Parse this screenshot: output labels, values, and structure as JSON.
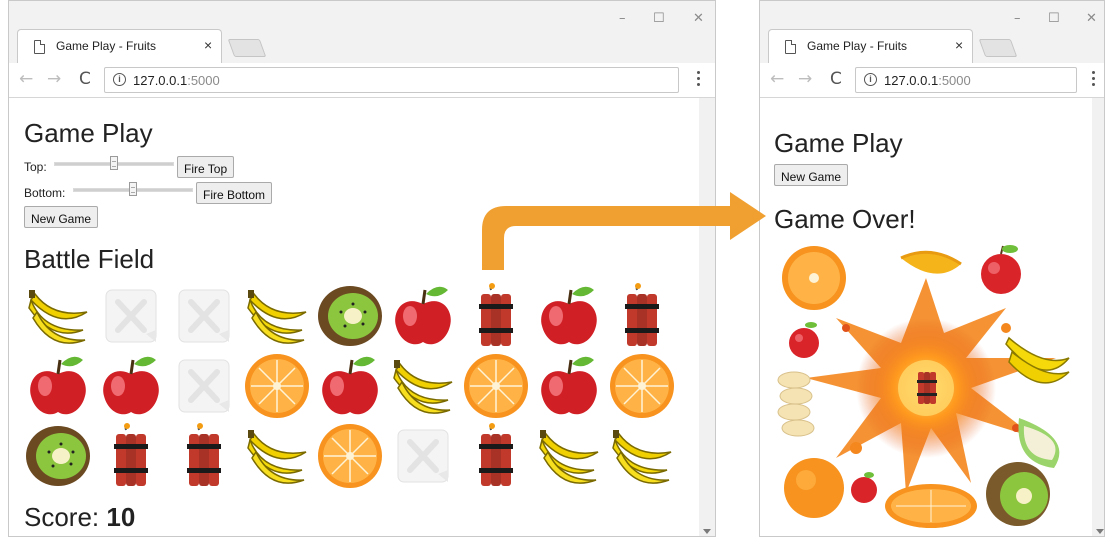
{
  "left_window": {
    "tab_title": "Game Play - Fruits",
    "tab_close": "×",
    "url_host": "127.0.0.1",
    "url_port": ":5000",
    "heading": "Game Play",
    "top_label": "Top:",
    "top_slider_value": 0.5,
    "fire_top": "Fire Top",
    "bottom_label": "Bottom:",
    "bottom_slider_value": 0.5,
    "fire_bottom": "Fire Bottom",
    "new_game": "New Game",
    "battle_heading": "Battle Field",
    "score_label": "Score:",
    "score_value": "10",
    "grid": [
      [
        "banana",
        "empty",
        "empty",
        "banana",
        "kiwi",
        "apple",
        "dynamite",
        "apple",
        "dynamite"
      ],
      [
        "apple",
        "apple",
        "empty",
        "orange",
        "apple",
        "banana",
        "orange",
        "apple",
        "orange"
      ],
      [
        "kiwi",
        "dynamite",
        "dynamite",
        "banana",
        "orange",
        "empty",
        "dynamite",
        "banana",
        "banana"
      ]
    ]
  },
  "right_window": {
    "tab_title": "Game Play - Fruits",
    "tab_close": "×",
    "url_host": "127.0.0.1",
    "url_port": ":5000",
    "heading": "Game Play",
    "new_game": "New Game",
    "game_over": "Game Over!",
    "scattered_items": [
      "orange",
      "mango",
      "apple",
      "apple",
      "banana",
      "banana-slices",
      "dynamite",
      "apple-slice",
      "orange",
      "apple",
      "orange-slice",
      "kiwi"
    ]
  },
  "window_controls": {
    "minimize": "–",
    "maximize": "☐",
    "close": "✕"
  },
  "nav": {
    "back": "←",
    "forward": "→",
    "reload": "C"
  },
  "arrow_color": "#f0a030"
}
